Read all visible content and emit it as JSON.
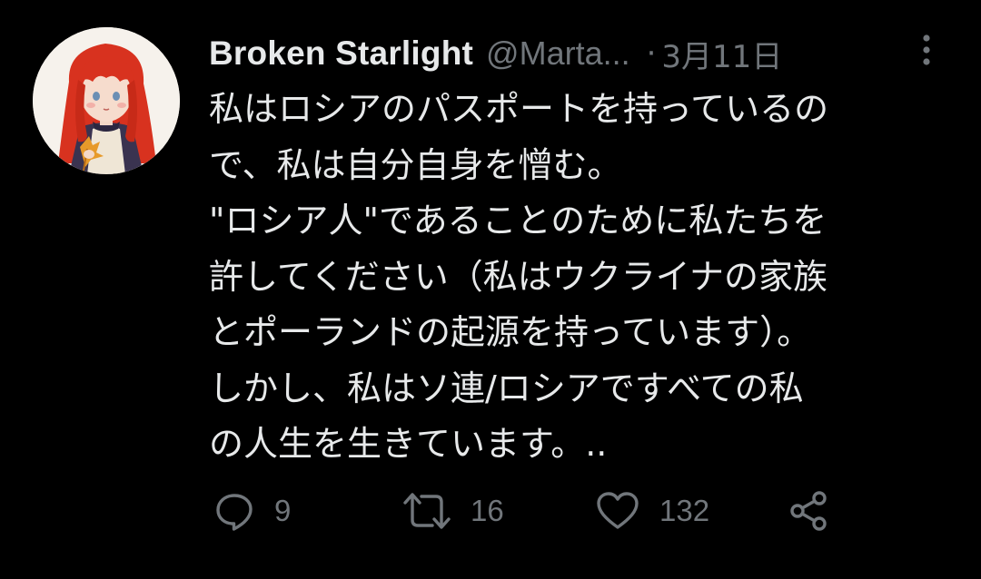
{
  "tweet": {
    "author": {
      "display_name": "Broken Starlight",
      "handle": "@Marta...",
      "avatar_icon": "avatar-illustration-red-haired-girl"
    },
    "separator": "·",
    "date": "3月11日",
    "more_icon": "more-vertical-icon",
    "text_lines": [
      "私はロシアのパスポートを持っているの",
      "で、私は自分自身を憎む。",
      "\"ロシア人\"であることのために私たちを",
      "許してください（私はウクライナの家族",
      "とポーランドの起源を持っています）。",
      "しかし、私はソ連/ロシアですべての私",
      "の人生を生きています。.."
    ],
    "actions": {
      "reply": {
        "icon": "reply-icon",
        "count": "9"
      },
      "retweet": {
        "icon": "retweet-icon",
        "count": "16"
      },
      "like": {
        "icon": "like-icon",
        "count": "132"
      },
      "share": {
        "icon": "share-icon"
      }
    }
  },
  "colors": {
    "background": "#000000",
    "primary_text": "#e7e9ea",
    "secondary_text": "#71767b"
  }
}
